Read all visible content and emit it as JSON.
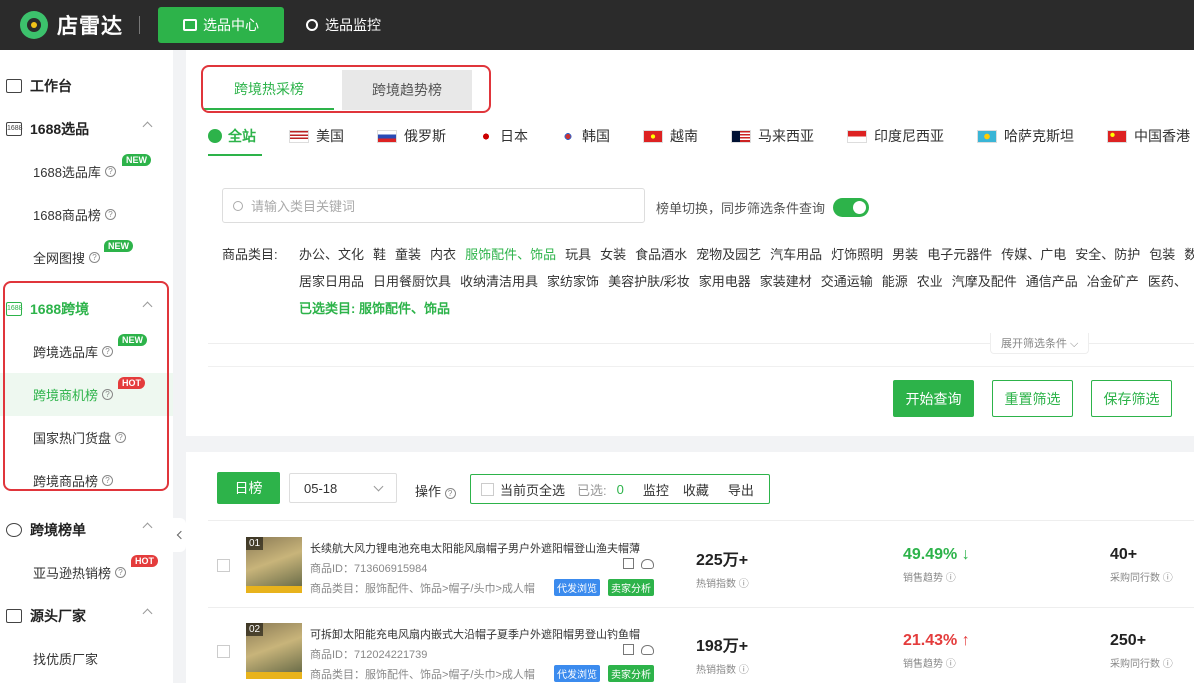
{
  "header": {
    "logo_text": "店雷达",
    "primary_nav": "选品中心",
    "secondary_nav": "选品监控"
  },
  "sidebar": {
    "workbench": "工作台",
    "group_1688": "1688选品",
    "item_1688_lib": "1688选品库",
    "item_1688_rank": "1688商品榜",
    "item_image_search": "全网图搜",
    "group_cross": "1688跨境",
    "item_cross_lib": "跨境选品库",
    "item_cross_opportunity": "跨境商机榜",
    "item_country_hot": "国家热门货盘",
    "item_cross_rank": "跨境商品榜",
    "group_cross_rankings": "跨境榜单",
    "item_amazon": "亚马逊热销榜",
    "group_factory": "源头厂家",
    "item_find_factory": "找优质厂家",
    "badge_new": "NEW",
    "badge_hot": "HOT",
    "group_1688_icon_text": "1688"
  },
  "tabs": {
    "active": "跨境热采榜",
    "inactive": "跨境趋势榜"
  },
  "countries": [
    "全站",
    "美国",
    "俄罗斯",
    "日本",
    "韩国",
    "越南",
    "马来西亚",
    "印度尼西亚",
    "哈萨克斯坦",
    "中国香港"
  ],
  "filters": {
    "search_placeholder": "请输入类目关键词",
    "sync_label": "榜单切换，同步筛选条件查询",
    "category_label": "商品类目:",
    "categories_row1": [
      "办公、文化",
      "鞋",
      "童装",
      "内衣",
      "服饰配件、饰品",
      "玩具",
      "女装",
      "食品酒水",
      "宠物及园艺",
      "汽车用品",
      "灯饰照明",
      "男装",
      "电子元器件",
      "传媒、广电",
      "安全、防护",
      "包装",
      "数"
    ],
    "categories_row2": [
      "居家日用品",
      "日用餐厨饮具",
      "收纳清洁用具",
      "家纺家饰",
      "美容护肤/彩妆",
      "家用电器",
      "家装建材",
      "交通运输",
      "能源",
      "农业",
      "汽摩及配件",
      "通信产品",
      "冶金矿产",
      "医药、"
    ],
    "selected_label": "已选类目: 服饰配件、饰品",
    "expand_label": "展开筛选条件 ⌵",
    "btn_search": "开始查询",
    "btn_reset": "重置筛选",
    "btn_save": "保存筛选"
  },
  "list": {
    "day_btn": "日榜",
    "date": "05-18",
    "op_label": "操作",
    "select_page": "当前页全选",
    "selected_label": "已选:",
    "selected_count": "0",
    "action_monitor": "监控",
    "action_collect": "收藏",
    "action_export": "导出"
  },
  "products": [
    {
      "rank": "01",
      "title": "长续航大风力锂电池充电太阳能风扇帽子男户外遮阳帽登山渔夫帽薄",
      "id": "商品ID：713606915984",
      "category": "商品类目：服饰配件、饰品>帽子/头巾>成人帽",
      "tag1": "代发浏览",
      "tag2": "卖家分析",
      "hot_index": "225万+",
      "hot_label": "热销指数",
      "trend": "49.49%",
      "trend_arrow": "↓",
      "trend_label": "销售趋势",
      "peers": "40+",
      "peers_label": "采购同行数"
    },
    {
      "rank": "02",
      "title": "可拆卸太阳能充电风扇内嵌式大沿帽子夏季户外遮阳帽男登山钓鱼帽",
      "id": "商品ID：712024221739",
      "category": "商品类目：服饰配件、饰品>帽子/头巾>成人帽",
      "tag1": "代发浏览",
      "tag2": "卖家分析",
      "hot_index": "198万+",
      "hot_label": "热销指数",
      "trend": "21.43%",
      "trend_arrow": "↑",
      "trend_label": "销售趋势",
      "peers": "250+",
      "peers_label": "采购同行数"
    }
  ],
  "colors": {
    "accent": "#2db34a",
    "topbar": "#2b2b2b",
    "highlight_outline": "#e0353b",
    "trend_up": "#e43c3c",
    "trend_down": "#2db34a"
  }
}
